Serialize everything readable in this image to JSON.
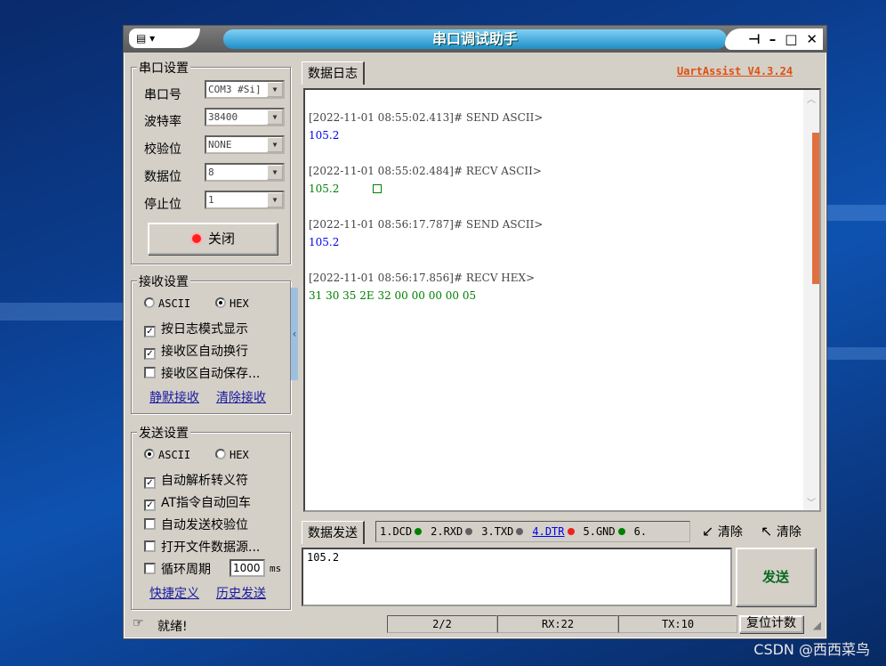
{
  "window": {
    "title": "串口调试助手",
    "version": "UartAssist V4.3.24"
  },
  "serial_settings": {
    "group_title": "串口设置",
    "fields": [
      {
        "label": "串口号",
        "value": "COM3 #Si]"
      },
      {
        "label": "波特率",
        "value": "38400"
      },
      {
        "label": "校验位",
        "value": "NONE"
      },
      {
        "label": "数据位",
        "value": "8"
      },
      {
        "label": "停止位",
        "value": "1"
      }
    ],
    "close_button": "关闭",
    "status_color": "#ff2020"
  },
  "recv_settings": {
    "group_title": "接收设置",
    "mode_ascii": "ASCII",
    "mode_hex": "HEX",
    "selected_mode": "HEX",
    "options": [
      {
        "label": "按日志模式显示",
        "checked": true
      },
      {
        "label": "接收区自动换行",
        "checked": true
      },
      {
        "label": "接收区自动保存...",
        "checked": false
      }
    ],
    "link1": "静默接收",
    "link2": "清除接收"
  },
  "send_settings": {
    "group_title": "发送设置",
    "mode_ascii": "ASCII",
    "mode_hex": "HEX",
    "selected_mode": "ASCII",
    "options": [
      {
        "label": "自动解析转义符",
        "checked": true
      },
      {
        "label": "AT指令自动回车",
        "checked": true
      },
      {
        "label": "自动发送校验位",
        "checked": false
      },
      {
        "label": "打开文件数据源...",
        "checked": false
      },
      {
        "label": "循环周期",
        "checked": false
      }
    ],
    "period_value": "1000",
    "period_unit": "ms",
    "link1": "快捷定义",
    "link2": "历史发送"
  },
  "log": {
    "tab": "数据日志",
    "entries": [
      {
        "header": "[2022-11-01 08:55:02.413]# SEND ASCII>",
        "body": "105.2",
        "color": "#0000ee"
      },
      {
        "header": "[2022-11-01 08:55:02.484]# RECV ASCII>",
        "body": "105.2",
        "color": "#008000"
      },
      {
        "header": "[2022-11-01 08:56:17.787]# SEND ASCII>",
        "body": "105.2",
        "color": "#0000ee"
      },
      {
        "header": "[2022-11-01 08:56:17.856]# RECV HEX>",
        "body": "31 30 35 2E 32 00 00 00 00 05",
        "color": "#008000"
      }
    ]
  },
  "send_area": {
    "tab": "数据发送",
    "pins": [
      {
        "label": "1.DCD",
        "color": "#008000"
      },
      {
        "label": "2.RXD",
        "color": "#606060"
      },
      {
        "label": "3.TXD",
        "color": "#606060"
      },
      {
        "label": "4.DTR",
        "color": "#ee2020"
      },
      {
        "label": "5.GND",
        "color": "#008000"
      },
      {
        "label": "6.",
        "color": "#606060"
      }
    ],
    "clear1": "清除",
    "clear2": "清除",
    "input_value": "105.2",
    "send_button": "发送"
  },
  "status": {
    "ready": "就绪!",
    "count": "2/2",
    "rx": "RX:22",
    "tx": "TX:10",
    "reset": "复位计数"
  },
  "watermark": "CSDN @西西菜鸟"
}
